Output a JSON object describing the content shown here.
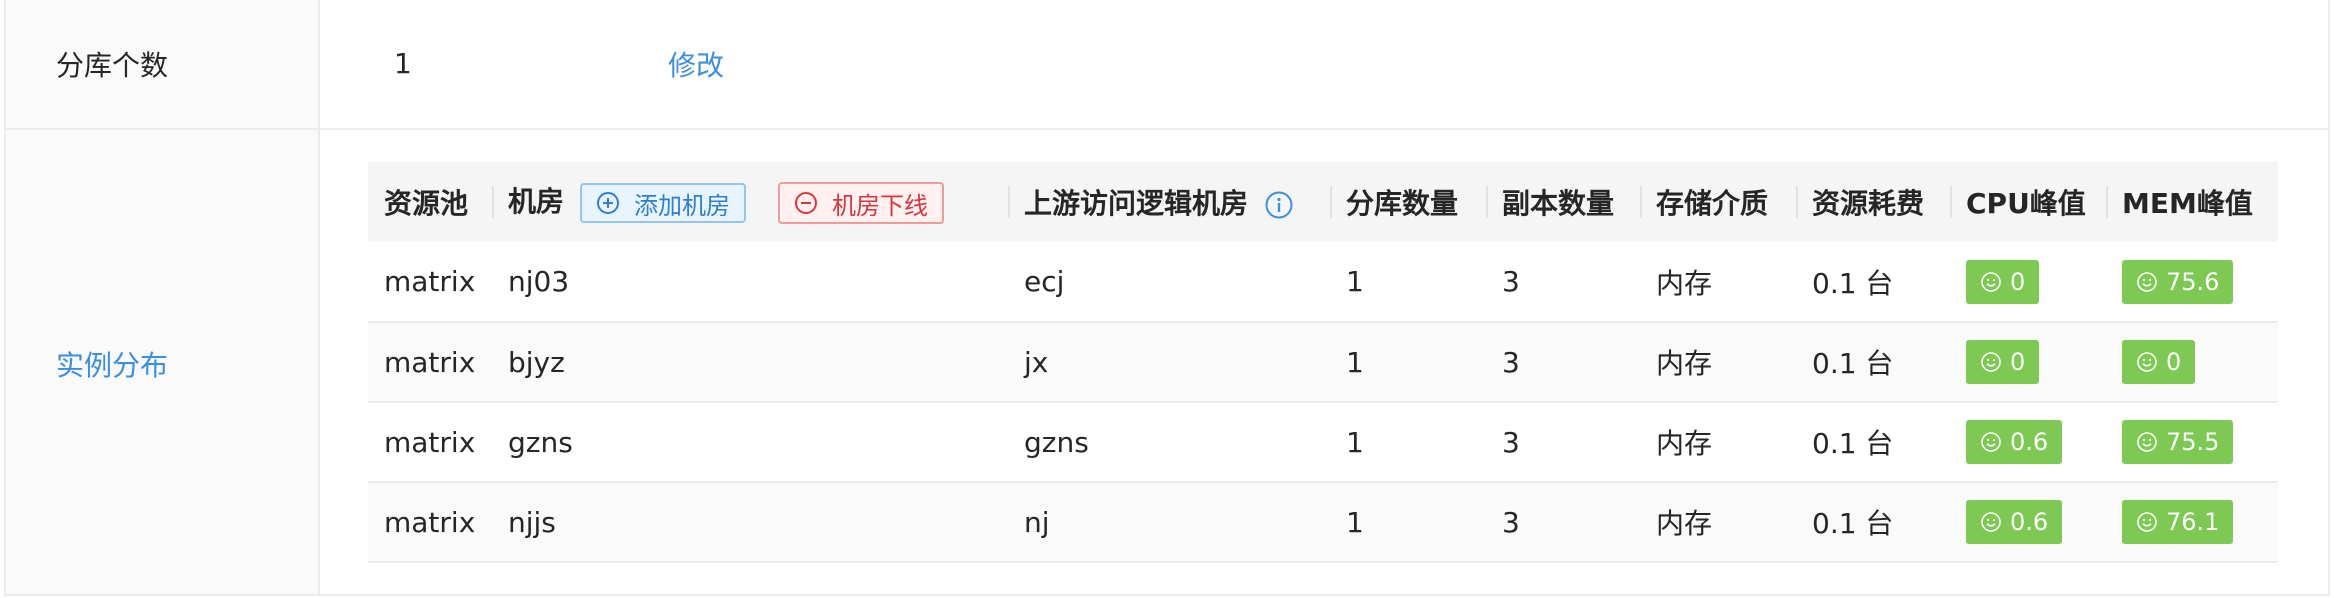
{
  "shard_count_row": {
    "label": "分库个数",
    "value": "1",
    "edit_label": "修改"
  },
  "instance_row": {
    "label": "实例分布"
  },
  "table": {
    "headers": {
      "pool": "资源池",
      "room": "机房",
      "add_room": "添加机房",
      "offline_room": "机房下线",
      "upstream_room": "上游访问逻辑机房",
      "shard_num": "分库数量",
      "replica_num": "副本数量",
      "storage": "存储介质",
      "cost": "资源耗费",
      "cpu_peak": "CPU峰值",
      "mem_peak": "MEM峰值"
    },
    "rows": [
      {
        "pool": "matrix",
        "room": "nj03",
        "upstream": "ecj",
        "shards": "1",
        "replicas": "3",
        "storage": "内存",
        "cost": "0.1 台",
        "cpu": "0",
        "mem": "75.6"
      },
      {
        "pool": "matrix",
        "room": "bjyz",
        "upstream": "jx",
        "shards": "1",
        "replicas": "3",
        "storage": "内存",
        "cost": "0.1 台",
        "cpu": "0",
        "mem": "0"
      },
      {
        "pool": "matrix",
        "room": "gzns",
        "upstream": "gzns",
        "shards": "1",
        "replicas": "3",
        "storage": "内存",
        "cost": "0.1 台",
        "cpu": "0.6",
        "mem": "75.5"
      },
      {
        "pool": "matrix",
        "room": "njjs",
        "upstream": "nj",
        "shards": "1",
        "replicas": "3",
        "storage": "内存",
        "cost": "0.1 台",
        "cpu": "0.6",
        "mem": "76.1"
      }
    ]
  },
  "icons": {
    "add": "plus-circle-icon",
    "remove": "minus-circle-icon",
    "info": "info-circle-icon",
    "badge": "smile-icon"
  },
  "colors": {
    "link": "#3a8fe0",
    "badge_green": "#7dc954",
    "danger": "#d9363e"
  }
}
